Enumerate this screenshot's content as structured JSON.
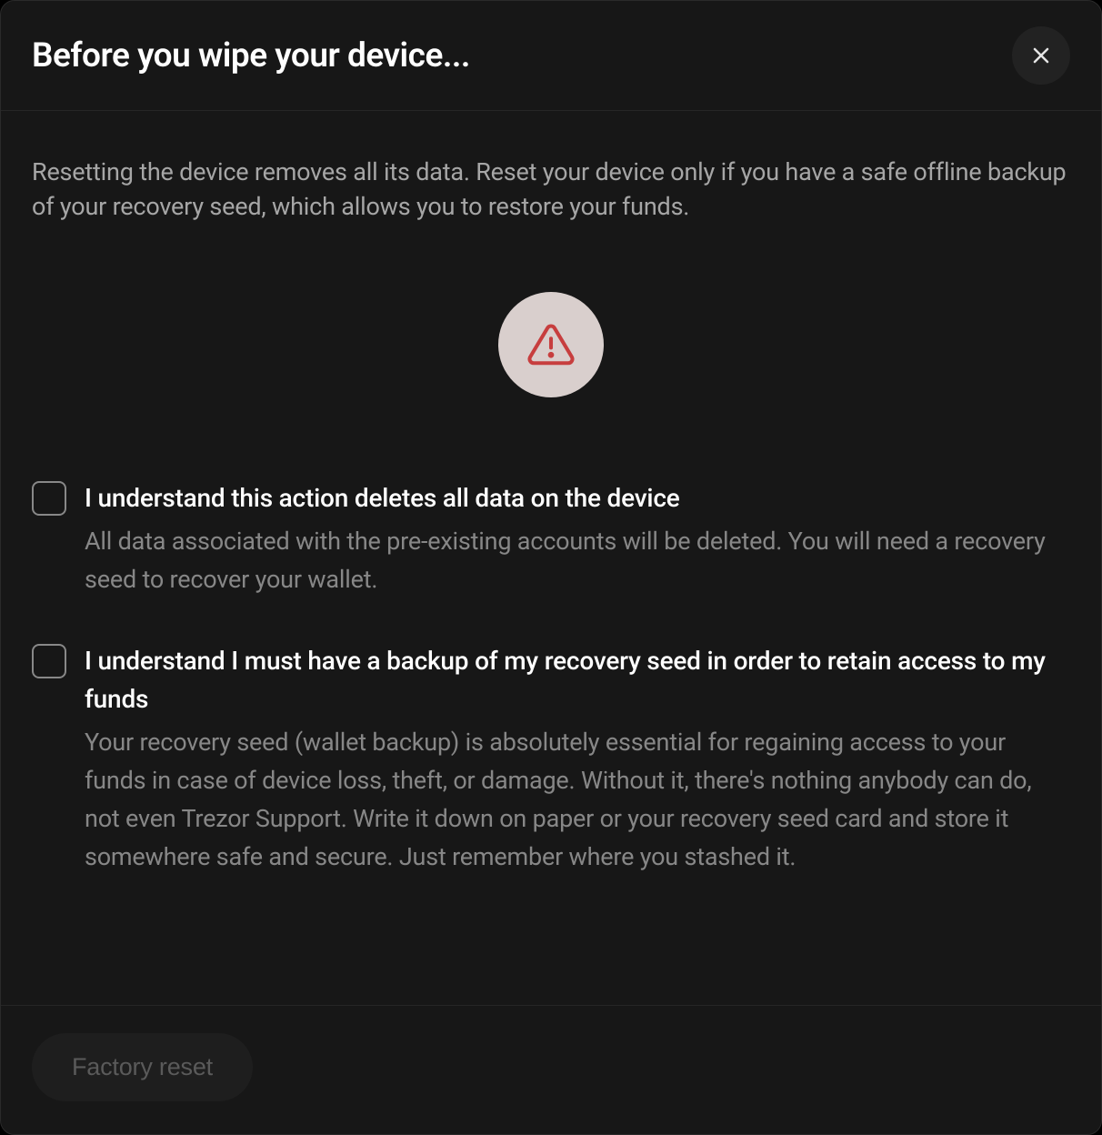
{
  "header": {
    "title": "Before you wipe your device..."
  },
  "body": {
    "intro_text": "Resetting the device removes all its data. Reset your device only if you have a safe offline backup of your recovery seed, which allows you to restore your funds.",
    "checkboxes": [
      {
        "title": "I understand this action deletes all data on the device",
        "description": "All data associated with the pre-existing accounts will be deleted. You will need a recovery seed to recover your wallet."
      },
      {
        "title": "I understand I must have a backup of my recovery seed in order to retain access to my funds",
        "description": "Your recovery seed (wallet backup) is absolutely essential for regaining access to your funds in case of device loss, theft, or damage. Without it, there's nothing anybody can do, not even Trezor Support. Write it down on paper or your recovery seed card and store it somewhere safe and secure. Just remember where you stashed it."
      }
    ]
  },
  "footer": {
    "factory_reset_label": "Factory reset"
  }
}
